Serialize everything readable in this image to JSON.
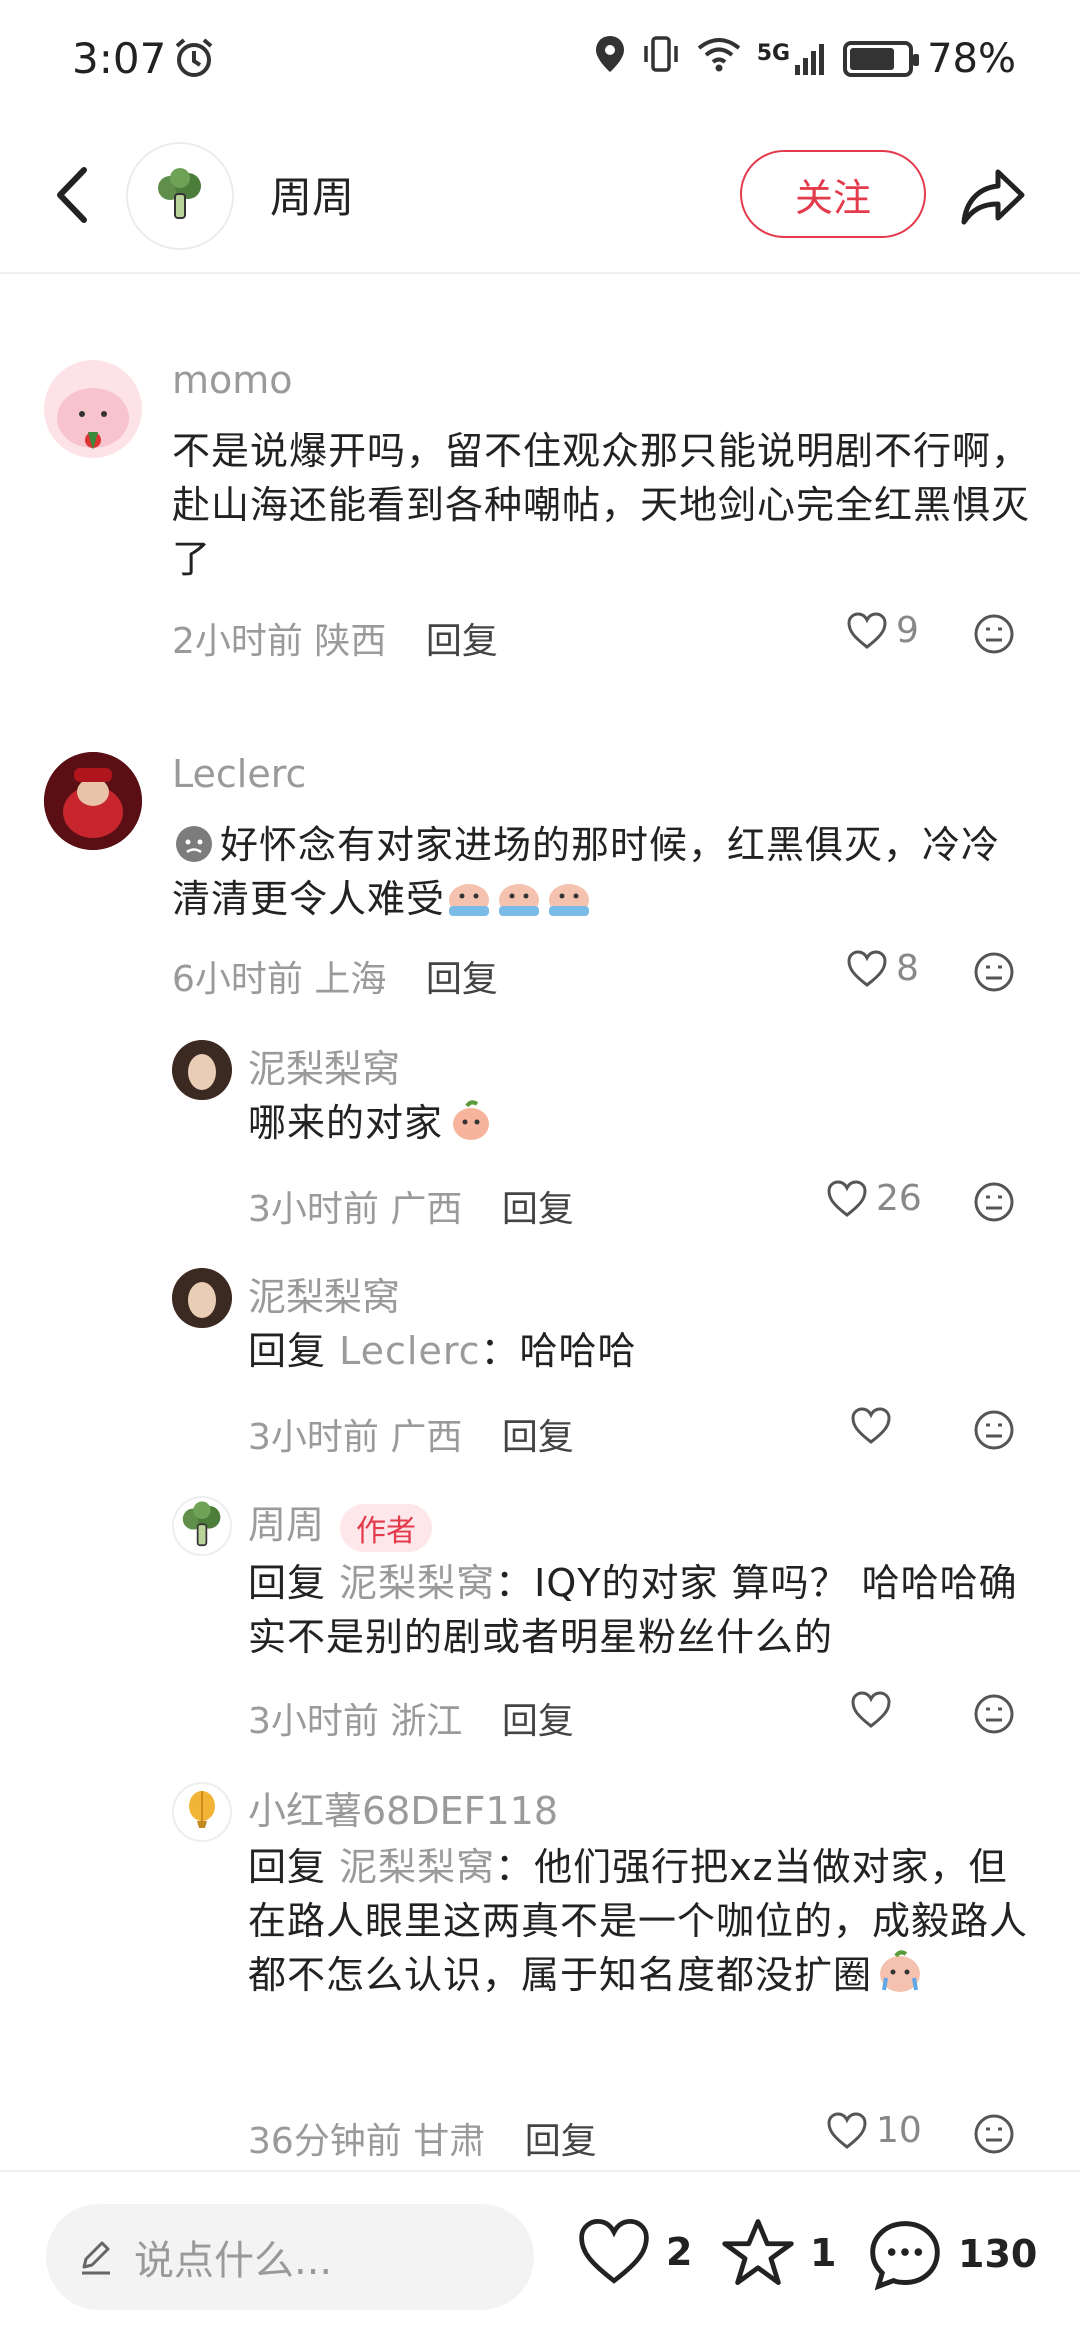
{
  "status": {
    "time": "3:07",
    "network": "5G",
    "battery": "78%",
    "battery_level": 0.78
  },
  "header": {
    "name": "周周",
    "follow_label": "关注"
  },
  "comments": [
    {
      "user": "momo",
      "text": "不是说爆开吗，留不住观众那只能说明剧不行啊，赴山海还能看到各种嘲帖，天地剑心完全红黑惧灭了",
      "time": "2小时前",
      "location": "陕西",
      "reply_label": "回复",
      "likes": "9"
    },
    {
      "user": "Leclerc",
      "text": "好怀念有对家进场的那时候，红黑俱灭，冷冷清清更令人难受",
      "time": "6小时前",
      "location": "上海",
      "reply_label": "回复",
      "likes": "8"
    }
  ],
  "replies": [
    {
      "user": "泥梨梨窝",
      "text": "哪来的对家",
      "time": "3小时前",
      "location": "广西",
      "reply_label": "回复",
      "likes": "26"
    },
    {
      "user": "泥梨梨窝",
      "reply_prefix": "回复",
      "reply_to": "Leclerc",
      "text": "：哈哈哈",
      "time": "3小时前",
      "location": "广西",
      "reply_label": "回复",
      "likes": ""
    },
    {
      "user": "周周",
      "author_tag": "作者",
      "reply_prefix": "回复",
      "reply_to": "泥梨梨窝",
      "text": "：IQY的对家 算吗？ 哈哈哈确实不是别的剧或者明星粉丝什么的",
      "time": "3小时前",
      "location": "浙江",
      "reply_label": "回复",
      "likes": ""
    },
    {
      "user": "小红薯68DEF118",
      "reply_prefix": "回复",
      "reply_to": "泥梨梨窝",
      "text": "：他们强行把xz当做对家，但在路人眼里这两真不是一个咖位的，成毅路人都不怎么认识，属于知名度都没扩圈",
      "time": "36分钟前",
      "location": "甘肃",
      "reply_label": "回复",
      "likes": "10"
    }
  ],
  "bottom": {
    "placeholder": "说点什么...",
    "likes": "2",
    "stars": "1",
    "comments": "130"
  }
}
